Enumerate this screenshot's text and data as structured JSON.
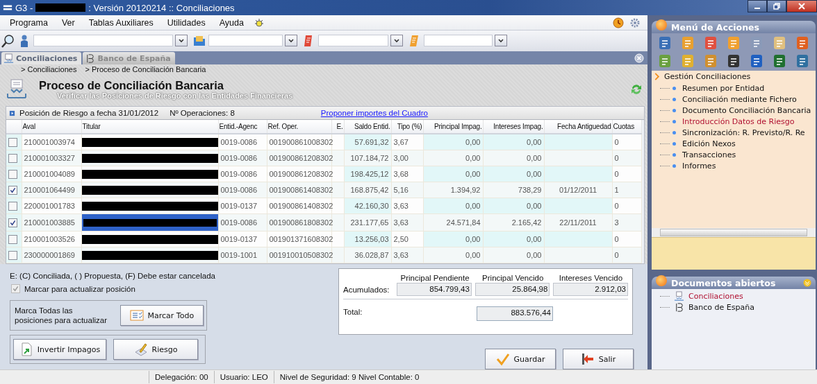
{
  "window": {
    "title_prefix": "G3 -",
    "title_suffix": ": Versión 20120214 :: Conciliaciones"
  },
  "menu": [
    "Programa",
    "Ver",
    "Tablas Auxiliares",
    "Utilidades",
    "Ayuda"
  ],
  "tabs": [
    {
      "label": "Conciliaciones",
      "selected": true
    },
    {
      "label": "Banco de España",
      "selected": false
    }
  ],
  "breadcrumb": [
    "> Conciliaciones",
    "> Proceso de Conciliación Bancaria"
  ],
  "header": {
    "title": "Proceso de Conciliación Bancaria",
    "subtitle": "Verificar las Posiciones de Riesgo con las Entidades Financieras"
  },
  "grid": {
    "caption": "Posición de Riesgo a fecha 31/01/2012",
    "count": "Nº Operaciones: 8",
    "link": "Proponer importes del Cuadro",
    "columns": [
      "Aval",
      "Titular",
      "Entid.-Agenc",
      "Ref. Oper.",
      "E.",
      "Saldo Entid.",
      "Tipo (%)",
      "Principal Impag.",
      "Intereses Impag.",
      "Fecha Antiguedad",
      "Cuotas"
    ],
    "rows": [
      {
        "checked": false,
        "selected": false,
        "cells": [
          "210001003974",
          "",
          "0019-0086",
          "001900861008302",
          "",
          "57.691,32",
          "3,67",
          "0,00",
          "0,00",
          "",
          "0"
        ]
      },
      {
        "checked": false,
        "selected": false,
        "cells": [
          "210001003327",
          "",
          "0019-0086",
          "001900861208302",
          "",
          "107.184,72",
          "3,00",
          "0,00",
          "0,00",
          "",
          "0"
        ]
      },
      {
        "checked": false,
        "selected": false,
        "cells": [
          "210001004089",
          "",
          "0019-0086",
          "001900861208302",
          "",
          "198.425,12",
          "3,68",
          "0,00",
          "0,00",
          "",
          "0"
        ]
      },
      {
        "checked": true,
        "selected": false,
        "cells": [
          "210001064499",
          "",
          "0019-0086",
          "001900861408302",
          "",
          "168.875,42",
          "5,16",
          "1.394,92",
          "738,29",
          "01/12/2011",
          "1"
        ]
      },
      {
        "checked": false,
        "selected": false,
        "cells": [
          "220001001783",
          "",
          "0019-0137",
          "001900861408302",
          "",
          "42.160,30",
          "3,63",
          "0,00",
          "0,00",
          "",
          "0"
        ]
      },
      {
        "checked": true,
        "selected": true,
        "cells": [
          "210001003885",
          "",
          "0019-0086",
          "001900861808302",
          "",
          "231.177,65",
          "3,63",
          "24.571,84",
          "2.165,42",
          "22/11/2011",
          "3"
        ]
      },
      {
        "checked": false,
        "selected": false,
        "cells": [
          "210001003526",
          "",
          "0019-0137",
          "001901371608302",
          "",
          "13.256,03",
          "2,50",
          "0,00",
          "0,00",
          "",
          "0"
        ]
      },
      {
        "checked": false,
        "selected": false,
        "cells": [
          "230000001869",
          "",
          "0019-1001",
          "001910010508302",
          "",
          "36.028,87",
          "3,63",
          "0,00",
          "0,00",
          "",
          "0"
        ]
      }
    ]
  },
  "legend": "E: (C) Conciliada, ( ) Propuesta, (F) Debe estar cancelada",
  "update_checkbox": {
    "label": "Marcar para actualizar posición",
    "checked": true,
    "disabled": true
  },
  "mark_all": {
    "text": "Marca Todas las posiciones para actualizar",
    "button": "Marcar Todo"
  },
  "action_buttons": [
    "Invertir Impagos",
    "Riesgo"
  ],
  "summary": {
    "headers": [
      "Principal Pendiente",
      "Principal Vencido",
      "Intereses Vencido"
    ],
    "row_label": "Acumulados:",
    "values": [
      "854.799,43",
      "25.864,98",
      "2.912,03"
    ],
    "total_label": "Total:",
    "total": "883.576,44"
  },
  "dialog_buttons": [
    "Guardar",
    "Salir"
  ],
  "status_bar": [
    "Delegación: 00",
    "Usuario: LEO",
    "Nivel de Seguridad: 9 Nivel Contable: 0"
  ],
  "actions_panel": {
    "title": "Menú de Acciones",
    "tree": {
      "label": "Gestión Conciliaciones",
      "children": [
        {
          "label": "Resumen por Entidad",
          "selected": false
        },
        {
          "label": "Conciliación mediante Fichero",
          "selected": false
        },
        {
          "label": "Documento Conciliación Bancaria",
          "selected": false
        },
        {
          "label": "Introducción Datos de Riesgo",
          "selected": true
        },
        {
          "label": "Sincronización:  R. Previsto/R. Re",
          "selected": false
        },
        {
          "label": "Edición Nexos",
          "selected": false
        },
        {
          "label": "Transacciones",
          "selected": false
        },
        {
          "label": "Informes",
          "selected": false
        }
      ]
    }
  },
  "documents_panel": {
    "title": "Documentos abiertos",
    "items": [
      {
        "label": "Conciliaciones",
        "selected": true
      },
      {
        "label": "Banco de España",
        "selected": false
      }
    ]
  }
}
